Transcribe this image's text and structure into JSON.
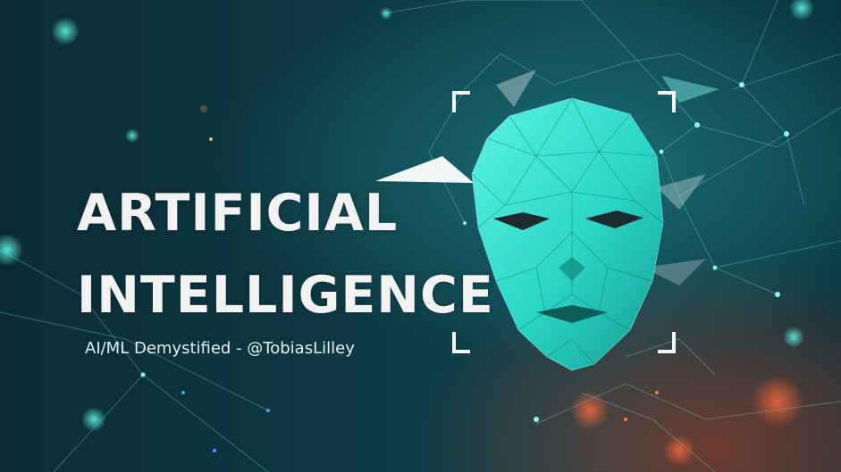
{
  "slide": {
    "title_line1": "ARTIFICIAL",
    "title_line2": "INTELLIGENCE",
    "subtitle": "AI/ML Demystified - @TobiasLilley"
  },
  "colors": {
    "background": "#0e3a44",
    "title": "#f2f2f2",
    "face": "#2ee0cf",
    "network_lines": "#7fdfe0",
    "glow_warm": "#be3c1e"
  },
  "icons": {
    "face": "low-poly-face-icon",
    "frame": "focus-brackets-icon"
  }
}
